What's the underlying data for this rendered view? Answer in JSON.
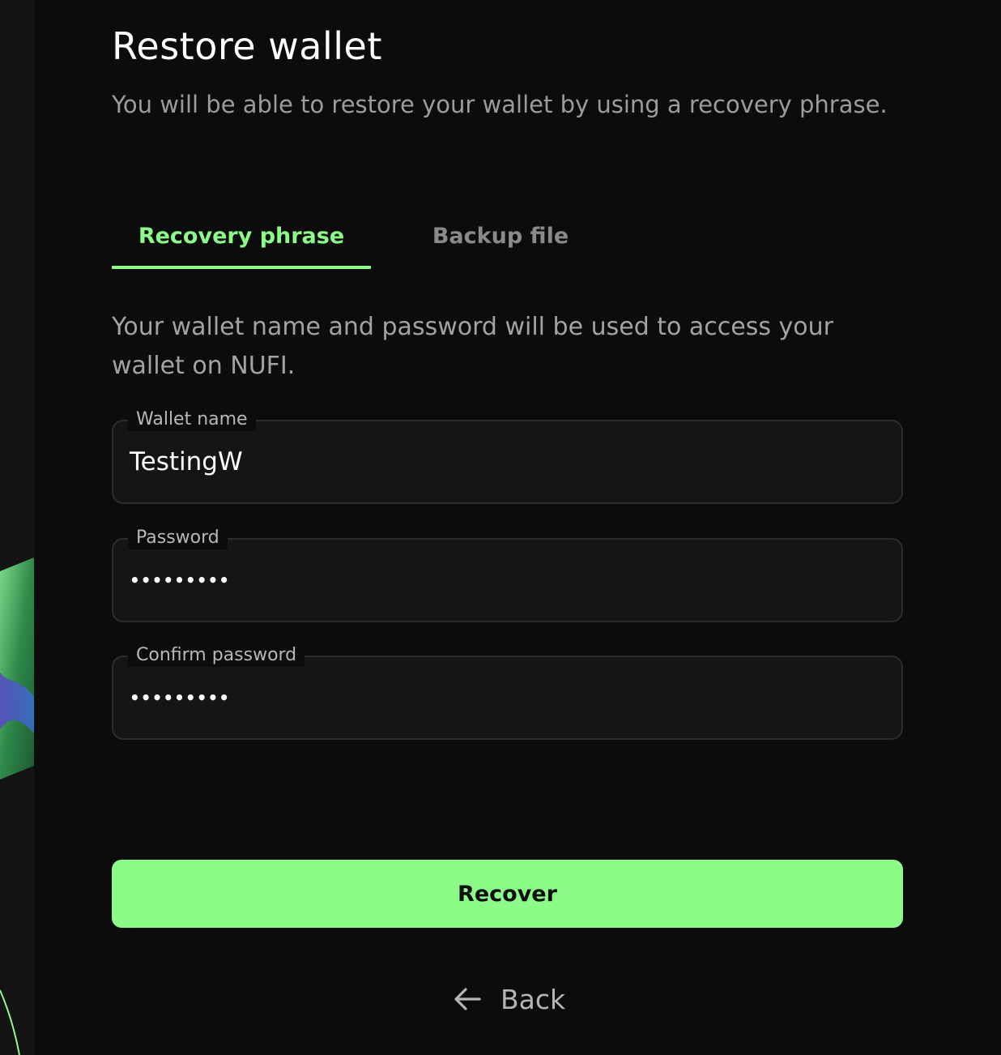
{
  "header": {
    "title": "Restore wallet",
    "subtitle": "You will be able to restore your wallet by using a recovery phrase."
  },
  "tabs": [
    {
      "label": "Recovery phrase",
      "active": true
    },
    {
      "label": "Backup file",
      "active": false
    }
  ],
  "info_text": "Your wallet name and password will be used to access your wallet on NUFI.",
  "form": {
    "wallet_name": {
      "label": "Wallet name",
      "value": "TestingW"
    },
    "password": {
      "label": "Password",
      "value": "•••••••••"
    },
    "confirm_password": {
      "label": "Confirm password",
      "value": "•••••••••"
    }
  },
  "actions": {
    "recover_label": "Recover",
    "back_label": "Back"
  },
  "colors": {
    "accent": "#8cfc89",
    "background": "#0c0c0c",
    "field_background": "#151515"
  }
}
